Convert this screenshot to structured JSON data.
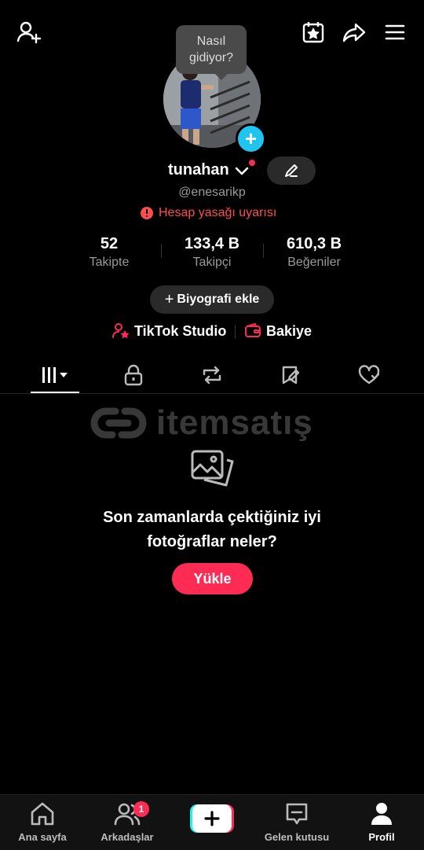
{
  "topbar": {
    "icons": [
      "add-friend-icon",
      "calendar-star-icon",
      "share-icon",
      "menu-icon"
    ]
  },
  "profile": {
    "bubble_text_line1": "Nasıl",
    "bubble_text_line2": "gidiyor?",
    "username": "tunahan",
    "handle": "@enesarikp",
    "warning": "Hesap yasağı uyarısı"
  },
  "stats": [
    {
      "value": "52",
      "label": "Takipte"
    },
    {
      "value": "133,4 B",
      "label": "Takipçi"
    },
    {
      "value": "610,3 B",
      "label": "Beğeniler"
    }
  ],
  "bio_button": "Biyografi ekle",
  "links": {
    "studio": "TikTok Studio",
    "balance": "Bakiye"
  },
  "watermark": "itemsatış",
  "empty_state": {
    "line1": "Son zamanlarda çektiğiniz iyi",
    "line2": "fotoğraflar neler?",
    "button": "Yükle"
  },
  "nav": {
    "home": "Ana sayfa",
    "friends": "Arkadaşlar",
    "friends_badge": "1",
    "inbox": "Gelen kutusu",
    "profile": "Profil"
  },
  "colors": {
    "accent": "#fe2c55",
    "warning": "#fe4d4d",
    "add_avatar": "#20c4f0"
  }
}
